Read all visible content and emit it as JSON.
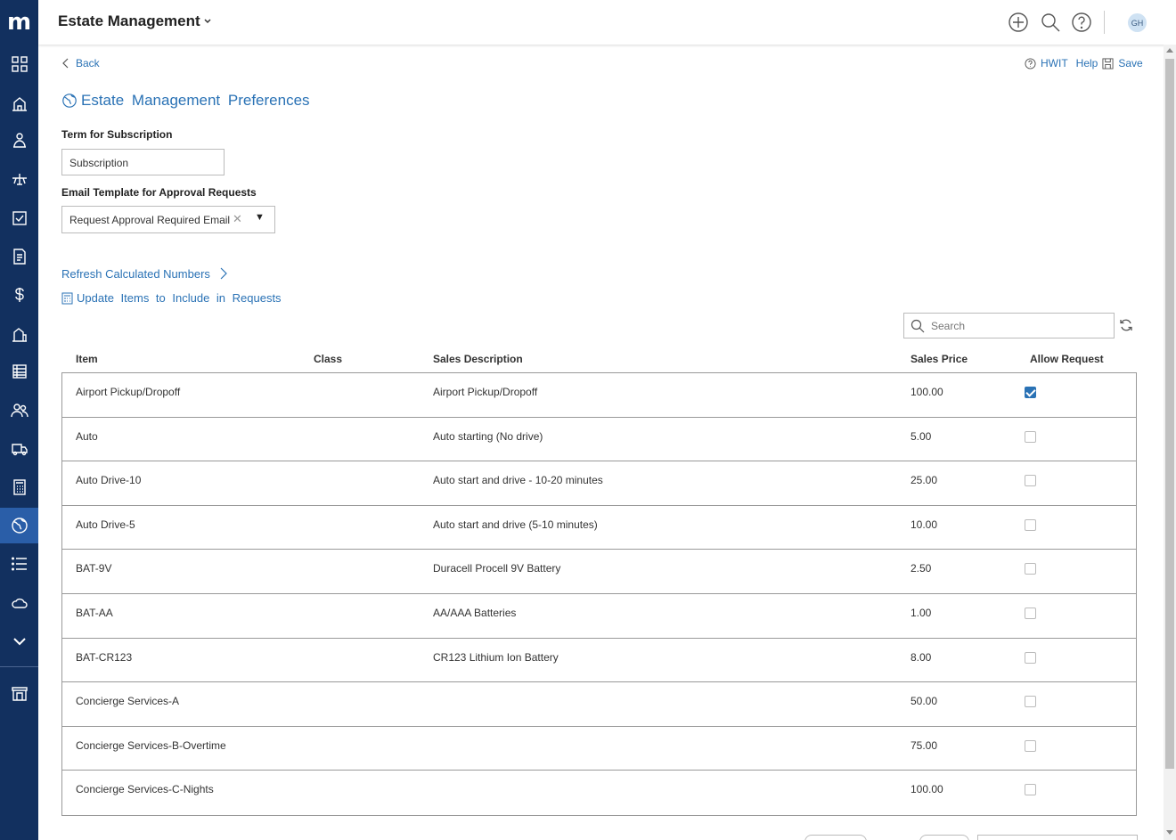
{
  "app": {
    "title": "Estate Management",
    "user_initials": "GH"
  },
  "toolbar": {
    "back": "Back",
    "hwit": "HWIT",
    "help": "Help",
    "save": "Save"
  },
  "page": {
    "title": "Estate Management Preferences"
  },
  "form": {
    "term_label": "Term for Subscription",
    "term_value": "Subscription",
    "email_label": "Email Template for Approval Requests",
    "email_value": "Request Approval Required Email"
  },
  "actions": {
    "refresh": "Refresh Calculated Numbers",
    "update": "Update Items to Include in Requests"
  },
  "search": {
    "placeholder": "Search"
  },
  "table": {
    "headers": {
      "item": "Item",
      "class": "Class",
      "description": "Sales Description",
      "price": "Sales Price",
      "allow": "Allow Request"
    },
    "rows": [
      {
        "item": "Airport Pickup/Dropoff",
        "class": "",
        "description": "Airport Pickup/Dropoff",
        "price": "100.00",
        "allow": true
      },
      {
        "item": "Auto",
        "class": "",
        "description": "Auto starting (No drive)",
        "price": "5.00",
        "allow": false
      },
      {
        "item": "Auto Drive-10",
        "class": "",
        "description": "Auto start and drive - 10-20 minutes",
        "price": "25.00",
        "allow": false
      },
      {
        "item": "Auto Drive-5",
        "class": "",
        "description": "Auto start and drive (5-10 minutes)",
        "price": "10.00",
        "allow": false
      },
      {
        "item": "BAT-9V",
        "class": "",
        "description": "Duracell Procell 9V Battery",
        "price": "2.50",
        "allow": false
      },
      {
        "item": "BAT-AA",
        "class": "",
        "description": "AA/AAA Batteries",
        "price": "1.00",
        "allow": false
      },
      {
        "item": "BAT-CR123",
        "class": "",
        "description": "CR123 Lithium Ion Battery",
        "price": "8.00",
        "allow": false
      },
      {
        "item": "Concierge Services-A",
        "class": "",
        "description": "",
        "price": "50.00",
        "allow": false
      },
      {
        "item": "Concierge Services-B-Overtime",
        "class": "",
        "description": "",
        "price": "75.00",
        "allow": false
      },
      {
        "item": "Concierge Services-C-Nights",
        "class": "",
        "description": "",
        "price": "100.00",
        "allow": false
      }
    ]
  },
  "sidebar": {
    "logo": "m",
    "items": [
      {
        "name": "dashboard-icon"
      },
      {
        "name": "property-icon"
      },
      {
        "name": "person-icon"
      },
      {
        "name": "aircraft-icon"
      },
      {
        "name": "task-check-icon"
      },
      {
        "name": "invoice-icon"
      },
      {
        "name": "dollar-icon"
      },
      {
        "name": "buildings-icon"
      },
      {
        "name": "ledger-icon"
      },
      {
        "name": "people-icon"
      },
      {
        "name": "truck-icon"
      },
      {
        "name": "calculator-icon"
      },
      {
        "name": "globe-icon",
        "active": true
      },
      {
        "name": "list-icon"
      },
      {
        "name": "cloud-icon"
      },
      {
        "name": "chevron-down-icon"
      },
      {
        "name": "store-icon"
      }
    ]
  },
  "colors": {
    "sidebar": "#12305f",
    "accent": "#2a72b5",
    "active_nav": "#2a5ea8"
  }
}
